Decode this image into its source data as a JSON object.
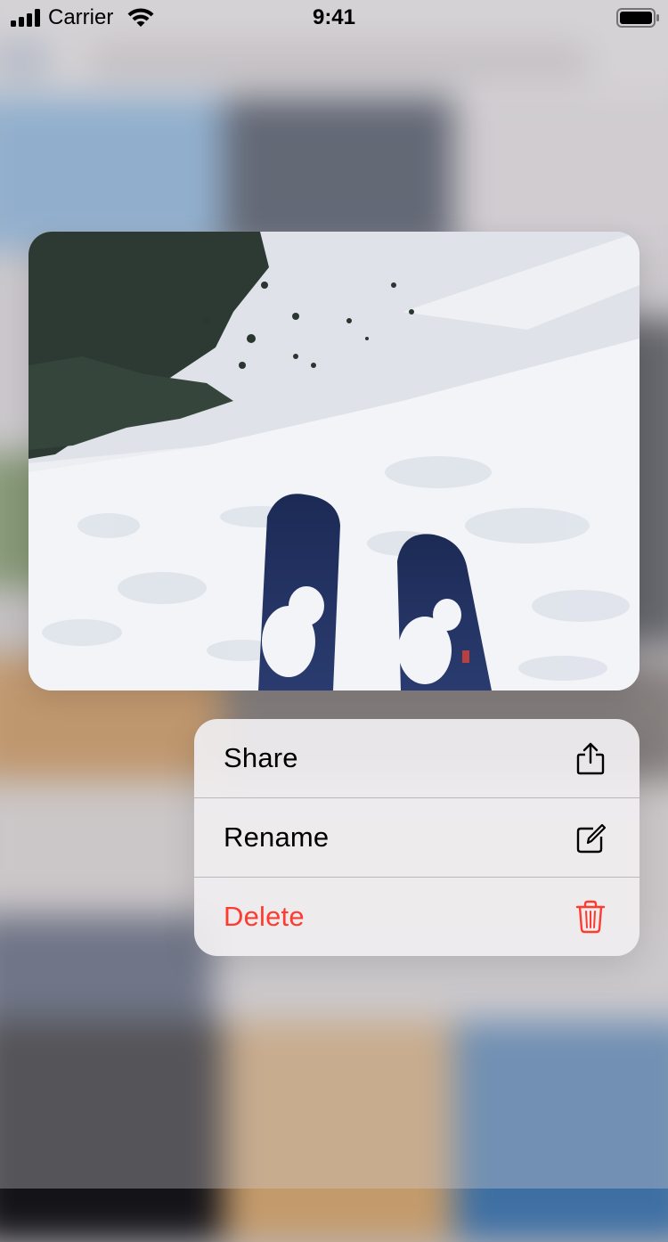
{
  "status_bar": {
    "carrier": "Carrier",
    "time": "9:41"
  },
  "preview": {
    "image_icon": "ski-photo"
  },
  "menu": {
    "items": [
      {
        "label": "Share",
        "icon": "share-icon"
      },
      {
        "label": "Rename",
        "icon": "compose-icon"
      },
      {
        "label": "Delete",
        "icon": "trash-icon",
        "color": "#ff3b30"
      }
    ]
  },
  "colors": {
    "destructive": "#ff3b30",
    "menu_background": "#f0eef0"
  }
}
